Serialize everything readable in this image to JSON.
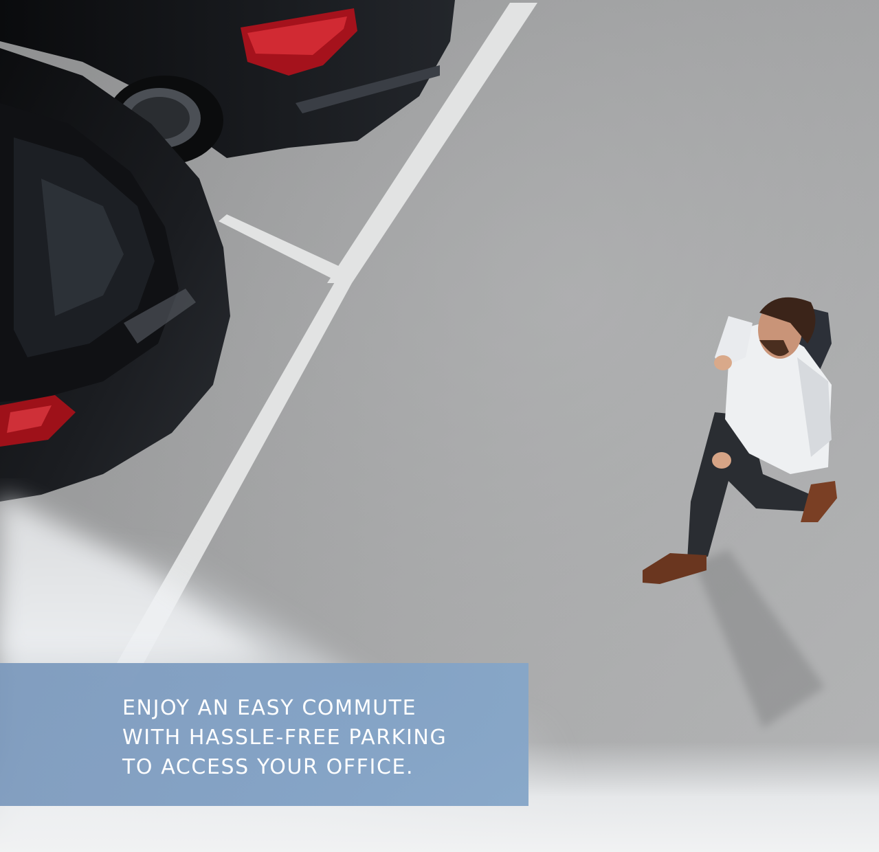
{
  "caption": {
    "lines": [
      "ENJOY AN EASY COMMUTE",
      "WITH HASSLE-FREE PARKING",
      "TO ACCESS YOUR OFFICE."
    ]
  },
  "colors": {
    "floor": "#9c9d9e",
    "floor_light": "#b3b4b5",
    "parking_line": "#e4e5e5",
    "car_body": "#17191c",
    "tail_light": "#b3141e",
    "shirt": "#eef0f2",
    "jeans": "#2b2e33",
    "shoes": "#6e3a22",
    "caption_bg": "#7f9fc3",
    "caption_text": "#ffffff"
  }
}
